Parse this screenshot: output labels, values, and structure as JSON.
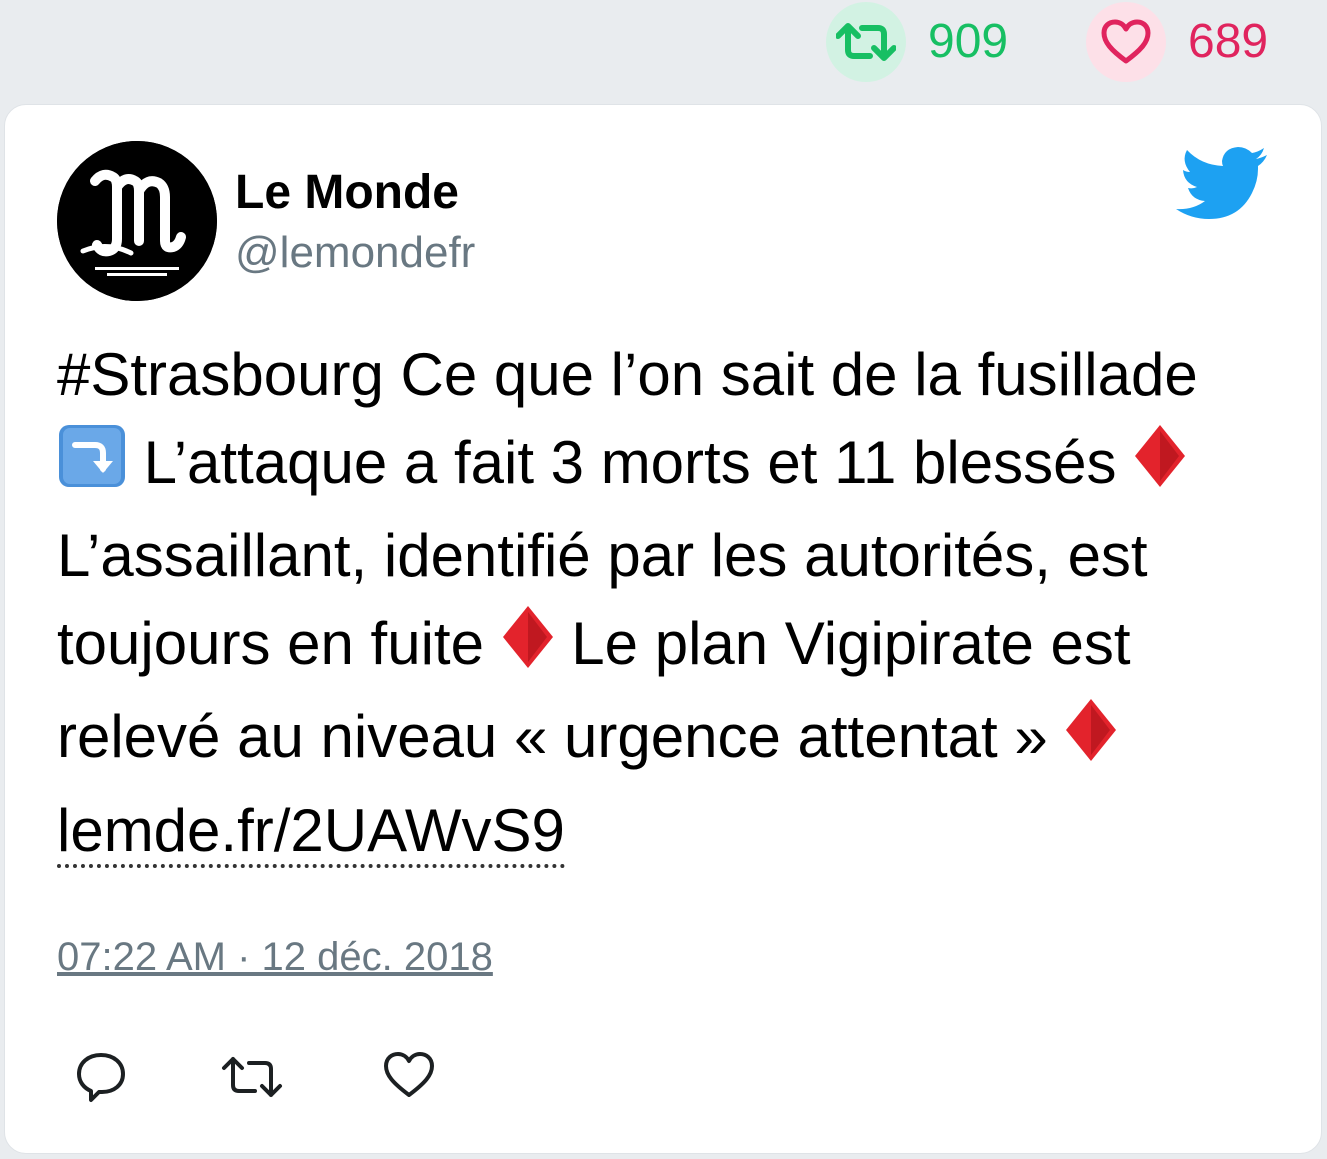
{
  "stats": {
    "retweet_count": "909",
    "like_count": "689"
  },
  "tweet": {
    "author_name": "Le Monde",
    "author_handle": "@lemondefr",
    "text_parts": {
      "p1": "#Strasbourg Ce que l’on sait de la fusillade ",
      "p2": " L’attaque a fait 3 morts et 11 blessés ",
      "p3": " L’assaillant, identifié par les autorités, est toujours en fuite ",
      "p4": " Le plan Vigipirate est relevé au niveau « urgence attentat » "
    },
    "link_text": "lemde.fr/2UAWvS9",
    "timestamp": "07:22 AM · 12 déc. 2018"
  },
  "icons": {
    "retweet": "retweet-icon",
    "like": "heart-icon",
    "brand": "twitter-bird-icon",
    "reply": "reply-icon",
    "inline": [
      "arrow-down-right-emoji",
      "red-diamond-emoji"
    ]
  },
  "colors": {
    "retweet": "#17bf63",
    "like": "#e0245e",
    "twitter_blue": "#1da1f2",
    "muted": "#697882"
  }
}
